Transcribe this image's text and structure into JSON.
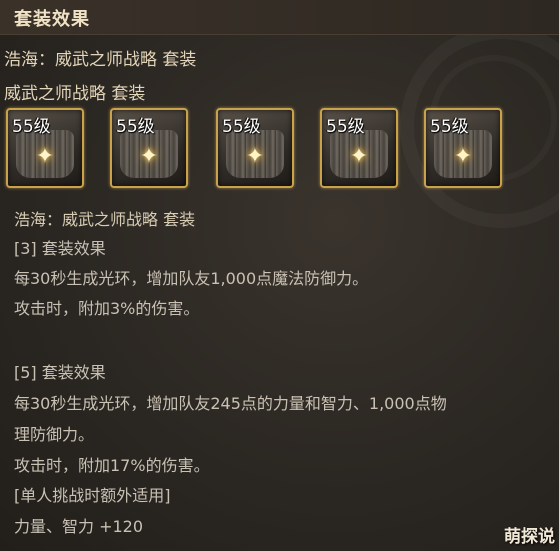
{
  "panel": {
    "title": "套装效果",
    "set_line_1": "浩海：威武之师战略 套装",
    "set_line_2": "威武之师战略 套装"
  },
  "items": [
    {
      "level": "55级",
      "icon": "armor-icon"
    },
    {
      "level": "55级",
      "icon": "armor-icon"
    },
    {
      "level": "55级",
      "icon": "armor-icon"
    },
    {
      "level": "55级",
      "icon": "armor-icon"
    },
    {
      "level": "55级",
      "icon": "boots-icon"
    }
  ],
  "effects": {
    "set_name": "浩海：威武之师战略 套装",
    "tier3_title": "[3] 套装效果",
    "tier3_line1": "每30秒生成光环，增加队友1,000点魔法防御力。",
    "tier3_line2": "攻击时，附加3%的伤害。",
    "tier5_title": "[5] 套装效果",
    "tier5_line1": "每30秒生成光环，增加队友245点的力量和智力、1,000点物",
    "tier5_line2": "理防御力。",
    "tier5_line3": "攻击时，附加17%的伤害。",
    "tier5_line4": "[单人挑战时额外适用]",
    "tier5_line5": "力量、智力 +120"
  },
  "watermark": {
    "text": "萌探说"
  },
  "colors": {
    "frame": "#c9a24a",
    "background": "#2a2622",
    "title": "#f0e2c4"
  }
}
